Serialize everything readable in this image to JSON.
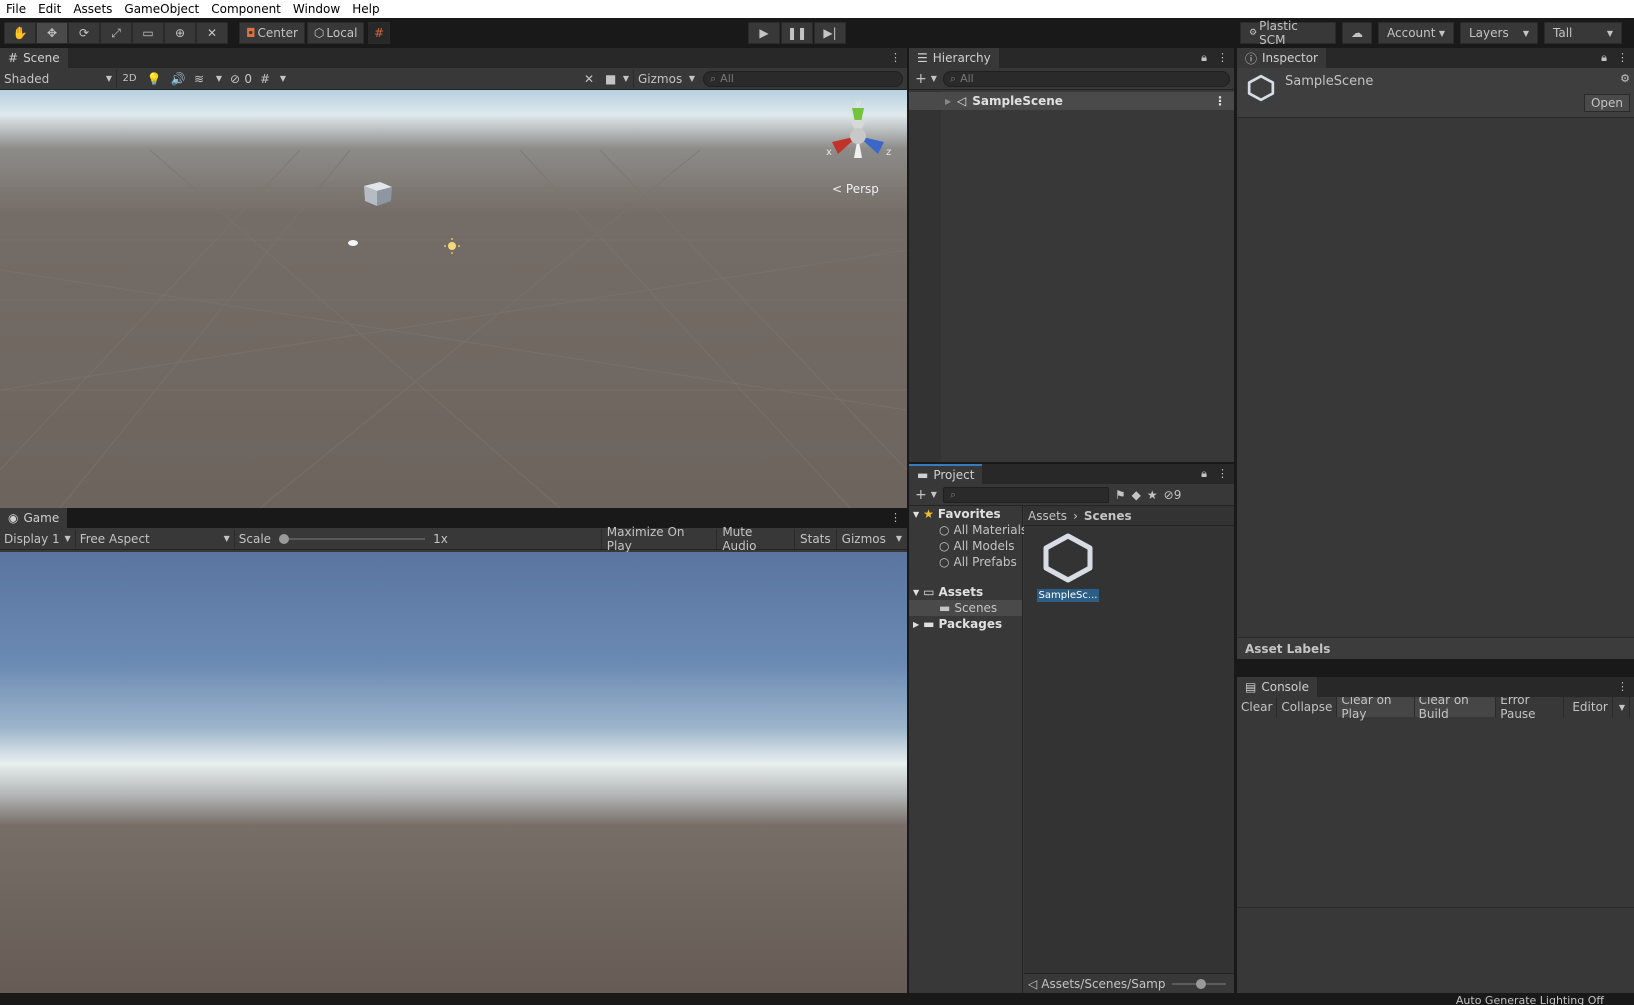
{
  "menu": [
    "File",
    "Edit",
    "Assets",
    "GameObject",
    "Component",
    "Window",
    "Help"
  ],
  "toolbar": {
    "pivot": "Center",
    "space": "Local",
    "plastic": "Plastic SCM",
    "account": "Account",
    "layers": "Layers",
    "layout": "Tall"
  },
  "scene": {
    "tab": "Scene",
    "shading": "Shaded",
    "mode2d": "2D",
    "hidden_count": "0",
    "gizmos": "Gizmos",
    "search_placeholder": "All",
    "persp": "Persp",
    "axis_x": "x",
    "axis_y": "y",
    "axis_z": "z"
  },
  "game": {
    "tab": "Game",
    "display": "Display 1",
    "aspect": "Free Aspect",
    "scale_label": "Scale",
    "scale_value": "1x",
    "scale_level": 0,
    "maximize": "Maximize On Play",
    "mute": "Mute Audio",
    "stats": "Stats",
    "gizmos": "Gizmos"
  },
  "hierarchy": {
    "tab": "Hierarchy",
    "search_placeholder": "All",
    "root": "SampleScene"
  },
  "project": {
    "tab": "Project",
    "hidden_count": "9",
    "favorites": "Favorites",
    "fav_items": [
      "All Materials",
      "All Models",
      "All Prefabs"
    ],
    "assets": "Assets",
    "scenes": "Scenes",
    "packages": "Packages",
    "crumb_root": "Assets",
    "crumb_current": "Scenes",
    "asset_name": "SampleSc...",
    "footer_path": "Assets/Scenes/Samp"
  },
  "inspector": {
    "tab": "Inspector",
    "title": "SampleScene",
    "open": "Open",
    "asset_labels": "Asset Labels"
  },
  "console": {
    "tab": "Console",
    "clear": "Clear",
    "collapse": "Collapse",
    "clear_on_play": "Clear on Play",
    "clear_on_build": "Clear on Build",
    "error_pause": "Error Pause",
    "editor": "Editor"
  },
  "status": "Auto Generate Lighting Off"
}
